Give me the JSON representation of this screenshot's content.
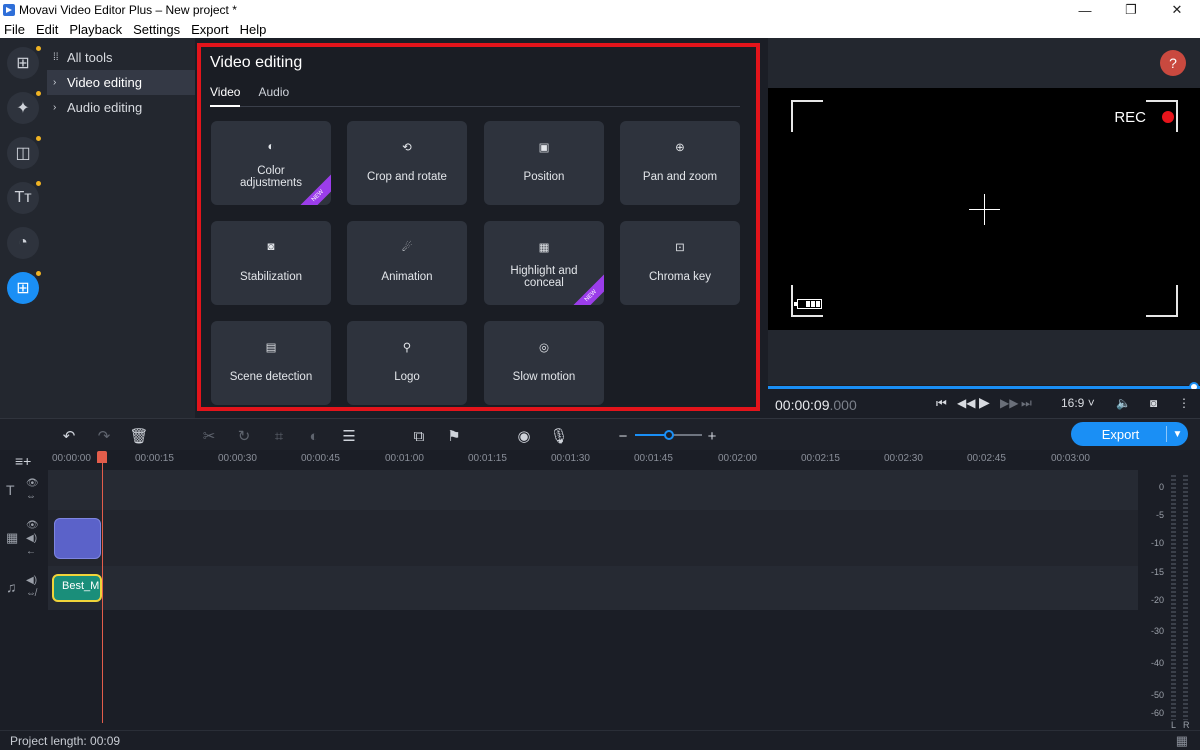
{
  "window": {
    "title": "Movavi Video Editor Plus – New project *",
    "controls": {
      "minimize": "—",
      "maximize": "❐",
      "close": "✕"
    }
  },
  "menu": [
    "File",
    "Edit",
    "Playback",
    "Settings",
    "Export",
    "Help"
  ],
  "rail": [
    {
      "name": "import-icon",
      "glyph": "⊞",
      "dot": true
    },
    {
      "name": "magic-wand-icon",
      "glyph": "✦",
      "dot": true
    },
    {
      "name": "transitions-icon",
      "glyph": "◫",
      "dot": true
    },
    {
      "name": "titles-icon",
      "glyph": "Tт",
      "dot": true
    },
    {
      "name": "stickers-icon",
      "glyph": "◔",
      "dot": false
    },
    {
      "name": "more-tools-icon",
      "glyph": "⊞",
      "dot": true
    }
  ],
  "categories": [
    {
      "label": "All tools",
      "icon": "grid-icon",
      "glyph": "⁞⁞"
    },
    {
      "label": "Video editing",
      "icon": "chevron-right-icon",
      "glyph": "›"
    },
    {
      "label": "Audio editing",
      "icon": "chevron-right-icon",
      "glyph": "›"
    }
  ],
  "panel": {
    "title": "Video editing",
    "tabs": [
      "Video",
      "Audio"
    ],
    "tiles": [
      {
        "label": "Color adjustments",
        "lines": [
          "Color",
          "adjustments"
        ],
        "icon": "color-adjust-icon",
        "glyph": "◐",
        "new": true
      },
      {
        "label": "Crop and rotate",
        "icon": "crop-rotate-icon",
        "glyph": "⟲",
        "new": false
      },
      {
        "label": "Position",
        "icon": "position-icon",
        "glyph": "▣",
        "new": false
      },
      {
        "label": "Pan and zoom",
        "icon": "pan-zoom-icon",
        "glyph": "⊕",
        "new": false
      },
      {
        "label": "Stabilization",
        "icon": "stabilization-icon",
        "glyph": "◙",
        "new": false
      },
      {
        "label": "Animation",
        "icon": "animation-icon",
        "glyph": "☄",
        "new": false
      },
      {
        "label": "Highlight and conceal",
        "lines": [
          "Highlight and",
          "conceal"
        ],
        "icon": "highlight-conceal-icon",
        "glyph": "▦",
        "new": true
      },
      {
        "label": "Chroma key",
        "icon": "chroma-key-icon",
        "glyph": "⊡",
        "new": false
      },
      {
        "label": "Scene detection",
        "icon": "scene-detection-icon",
        "glyph": "▤",
        "new": false
      },
      {
        "label": "Logo",
        "icon": "logo-stamp-icon",
        "glyph": "⚲",
        "new": false
      },
      {
        "label": "Slow motion",
        "icon": "slow-motion-icon",
        "glyph": "◎",
        "new": false
      }
    ],
    "new_badge": "NEW"
  },
  "preview": {
    "help": "?",
    "rec": "REC",
    "time": "00:00:09",
    "time_ms": ".000",
    "aspect": "16:9 ˅",
    "progress": 1.0
  },
  "toolbar": {
    "export_label": "Export",
    "zoom_minus": "−",
    "zoom_plus": "+",
    "zoom_level": 0.5
  },
  "ruler": [
    "00:00:00",
    "00:00:15",
    "00:00:30",
    "00:00:45",
    "00:01:00",
    "00:01:15",
    "00:01:30",
    "00:01:45",
    "00:02:00",
    "00:02:15",
    "00:02:30",
    "00:02:45",
    "00:03:00"
  ],
  "clips": {
    "audio_label": "Best_M"
  },
  "meter": {
    "levels": [
      "0",
      "-5",
      "-10",
      "-15",
      "-20",
      "-30",
      "-40",
      "-50",
      "-60"
    ],
    "left": "L",
    "right": "R"
  },
  "status": {
    "project_length": "Project length: 00:09"
  },
  "colors": {
    "accent": "#1a8ff5",
    "highlight_border": "#e3141b",
    "new_badge": "#9b3dea",
    "rec_dot": "#e8141b",
    "playhead": "#e35d4b"
  }
}
